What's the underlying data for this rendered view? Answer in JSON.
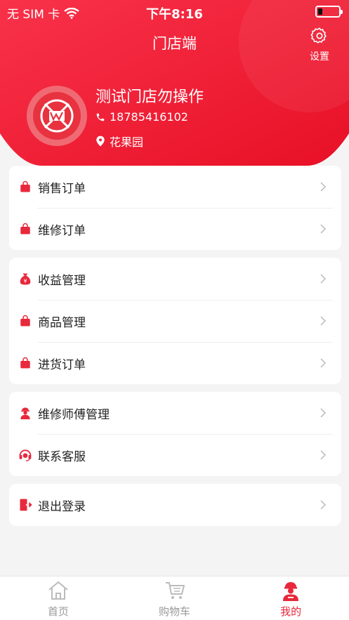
{
  "status_bar": {
    "carrier": "无 SIM 卡",
    "time": "下午8:16"
  },
  "header": {
    "title": "门店端",
    "settings_label": "设置"
  },
  "profile": {
    "store_name": "测试门店勿操作",
    "phone": "18785416102",
    "location": "花果园"
  },
  "menu": {
    "group1": [
      {
        "label": "销售订单",
        "icon": "shopping-bag-icon"
      },
      {
        "label": "维修订单",
        "icon": "shopping-bag-icon"
      }
    ],
    "group2": [
      {
        "label": "收益管理",
        "icon": "money-bag-icon"
      },
      {
        "label": "商品管理",
        "icon": "shopping-bag-icon"
      },
      {
        "label": "进货订单",
        "icon": "shopping-bag-icon"
      }
    ],
    "group3": [
      {
        "label": "维修师傅管理",
        "icon": "worker-icon"
      },
      {
        "label": "联系客服",
        "icon": "headset-icon"
      }
    ],
    "group4": [
      {
        "label": "退出登录",
        "icon": "logout-icon"
      }
    ]
  },
  "tabbar": [
    {
      "label": "首页",
      "icon": "home-icon",
      "active": false
    },
    {
      "label": "购物车",
      "icon": "cart-icon",
      "active": false
    },
    {
      "label": "我的",
      "icon": "user-icon",
      "active": true
    }
  ],
  "colors": {
    "brand_red": "#e8283c",
    "header_red": "#f0223a",
    "background": "#f4f4f4"
  }
}
